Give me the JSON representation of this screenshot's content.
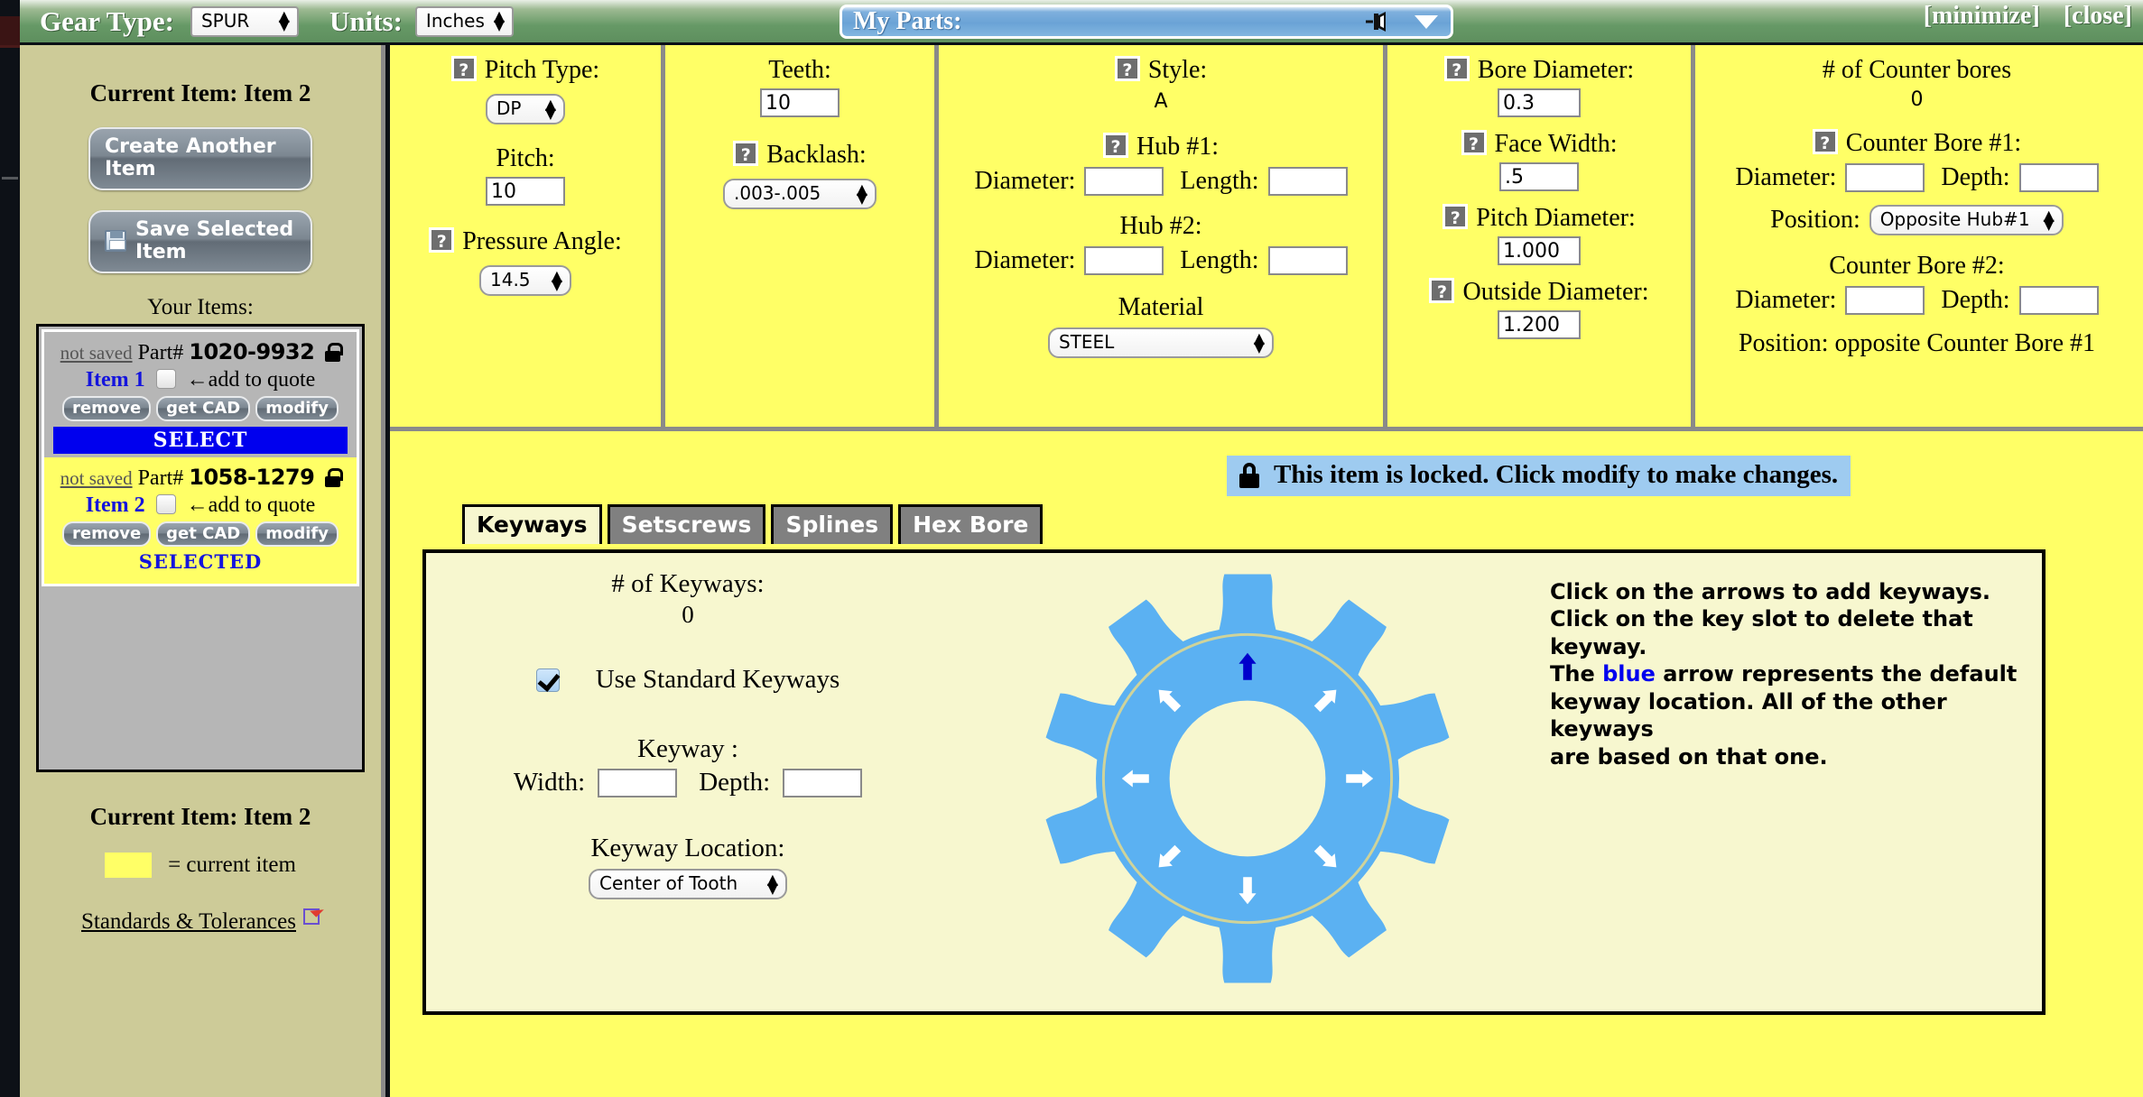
{
  "header": {
    "gear_type_label": "Gear Type:",
    "gear_type_value": "SPUR",
    "units_label": "Units:",
    "units_value": "Inches",
    "my_parts_label": "My Parts:",
    "minimize_label": "[minimize]",
    "close_label": "[close]"
  },
  "sidebar": {
    "current_item_top": "Current Item: Item 2",
    "create_button": "Create Another Item",
    "save_button": "Save Selected Item",
    "your_items_label": "Your Items:",
    "items": [
      {
        "status": "not saved",
        "part_prefix": "Part#",
        "part_number": "1020-9932",
        "item_name": "Item 1",
        "add_to_quote": "←add to quote",
        "remove": "remove",
        "get_cad": "get CAD",
        "modify": "modify",
        "state_label": "SELECT",
        "state": "unselected"
      },
      {
        "status": "not saved",
        "part_prefix": "Part#",
        "part_number": "1058-1279",
        "item_name": "Item 2",
        "add_to_quote": "←add to quote",
        "remove": "remove",
        "get_cad": "get CAD",
        "modify": "modify",
        "state_label": "SELECTED",
        "state": "selected"
      }
    ],
    "current_item_bottom": "Current Item: Item 2",
    "legend_text": "= current item",
    "legend_color": "#ffff66",
    "standards_link": "Standards & Tolerances"
  },
  "params": {
    "pitch_type_label": "Pitch Type:",
    "pitch_type_value": "DP",
    "pitch_label": "Pitch:",
    "pitch_value": "10",
    "pressure_angle_label": "Pressure Angle:",
    "pressure_angle_value": "14.5",
    "teeth_label": "Teeth:",
    "teeth_value": "10",
    "backlash_label": "Backlash:",
    "backlash_value": ".003-.005",
    "style_label": "Style:",
    "style_value": "A",
    "hub1_label": "Hub #1:",
    "hub1_diameter_label": "Diameter:",
    "hub1_diameter_value": "",
    "hub1_length_label": "Length:",
    "hub1_length_value": "",
    "hub2_label": "Hub #2:",
    "hub2_diameter_label": "Diameter:",
    "hub2_diameter_value": "",
    "hub2_length_label": "Length:",
    "hub2_length_value": "",
    "material_label": "Material",
    "material_value": "STEEL",
    "bore_diameter_label": "Bore Diameter:",
    "bore_diameter_value": "0.3",
    "face_width_label": "Face Width:",
    "face_width_value": ".5",
    "pitch_diameter_label": "Pitch Diameter:",
    "pitch_diameter_value": "1.000",
    "outside_diameter_label": "Outside Diameter:",
    "outside_diameter_value": "1.200",
    "counterbores_label": "# of Counter bores",
    "counterbores_count": "0",
    "cb1_label": "Counter Bore #1:",
    "cb1_diameter_label": "Diameter:",
    "cb1_diameter_value": "",
    "cb1_depth_label": "Depth:",
    "cb1_depth_value": "",
    "cb1_position_label": "Position:",
    "cb1_position_value": "Opposite Hub#1",
    "cb2_label": "Counter Bore #2:",
    "cb2_diameter_label": "Diameter:",
    "cb2_diameter_value": "",
    "cb2_depth_label": "Depth:",
    "cb2_depth_value": "",
    "cb2_position_text": "Position: opposite Counter Bore #1"
  },
  "lock_note": "This item is locked. Click modify to make changes.",
  "tabs": [
    {
      "label": "Keyways",
      "active": true
    },
    {
      "label": "Setscrews",
      "active": false
    },
    {
      "label": "Splines",
      "active": false
    },
    {
      "label": "Hex Bore",
      "active": false
    }
  ],
  "keyways": {
    "count_label": "# of Keyways:",
    "count_value": "0",
    "use_standard_label": "Use Standard Keyways",
    "use_standard_checked": true,
    "keyway_label": "Keyway :",
    "width_label": "Width:",
    "width_value": "",
    "depth_label": "Depth:",
    "depth_value": "",
    "location_label": "Keyway Location:",
    "location_value": "Center of Tooth",
    "instructions_line1": "Click on the arrows to add keyways.",
    "instructions_line2": "Click on the key slot to delete that keyway.",
    "instructions_line3a": "The ",
    "instructions_blue": "blue",
    "instructions_line3b": " arrow represents the default",
    "instructions_line4": "keyway location. All of the other keyways",
    "instructions_line5": "are based on that one.",
    "gear_teeth": 10,
    "gear_color": "#5bb1f2",
    "default_arrow_color": "#0000cc",
    "arrow_color": "#ffffff",
    "arrow_count": 8
  }
}
